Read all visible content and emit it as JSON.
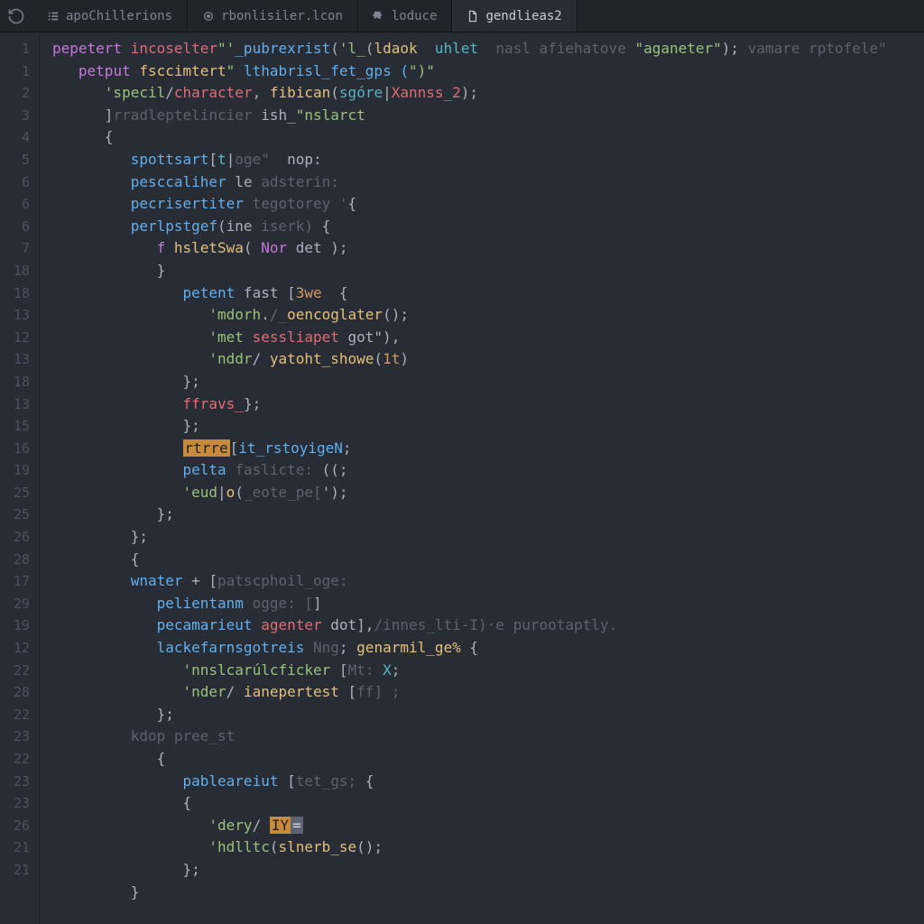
{
  "tabs": [
    {
      "label": "apoChillerions",
      "icon": "list-icon",
      "active": false
    },
    {
      "label": "rbonlisiler.lcon",
      "icon": "target-icon",
      "active": false
    },
    {
      "label": "loduce",
      "icon": "puzzle-icon",
      "active": false
    },
    {
      "label": "gendlieas2",
      "icon": "file-icon",
      "active": true
    }
  ],
  "gutter": [
    "1",
    "1",
    "2",
    "3",
    "4",
    "5",
    "6",
    "6",
    "6",
    "7",
    "18",
    "18",
    "13",
    "12",
    "13",
    "18",
    "13",
    "15",
    "16",
    "19",
    "25",
    "25",
    "26",
    "28",
    "17",
    "29",
    "19",
    "12",
    "22",
    "28",
    "22",
    "23",
    "22",
    "23",
    "23",
    "26",
    "21",
    "21"
  ],
  "code": {
    "lines": [
      {
        "indent": 0,
        "tokens": [
          [
            "kw",
            "pepetert"
          ],
          [
            "op",
            " "
          ],
          [
            "prop",
            "incoselter"
          ],
          [
            "str",
            "\"'"
          ],
          [
            "kw2",
            "_pubrexrist"
          ],
          [
            "op",
            "("
          ],
          [
            "str",
            "'l_"
          ],
          [
            "op",
            "("
          ],
          [
            "fn",
            "ldaok"
          ],
          [
            "op",
            "  "
          ],
          [
            "var",
            "uhlet"
          ],
          [
            "op",
            "  "
          ],
          [
            "com",
            "nasl afiehatove "
          ],
          [
            "str",
            "\"aganeter\""
          ],
          [
            "op",
            "); "
          ],
          [
            "com",
            "vamare rptofele\""
          ]
        ]
      },
      {
        "indent": 1,
        "tokens": [
          [
            "kw",
            "petput"
          ],
          [
            "op",
            " "
          ],
          [
            "fn",
            "fsccimtert"
          ],
          [
            "str",
            "\" "
          ],
          [
            "kw2",
            "lthabrisl_fet_gps ("
          ],
          [
            "str",
            "\")\""
          ]
        ]
      },
      {
        "indent": 2,
        "tokens": [
          [
            "str",
            "'specil"
          ],
          [
            "op",
            "/"
          ],
          [
            "prop",
            "character"
          ],
          [
            "op",
            ", "
          ],
          [
            "fn",
            "fibican"
          ],
          [
            "op",
            "("
          ],
          [
            "var",
            "sgóre"
          ],
          [
            "op",
            "|"
          ],
          [
            "prop",
            "Xannss_2"
          ],
          [
            "op",
            ");"
          ]
        ]
      },
      {
        "indent": 2,
        "tokens": [
          [
            "op",
            "]"
          ],
          [
            "com",
            "rradleptelincier"
          ],
          [
            "op",
            " ish_"
          ],
          [
            "str",
            "\"nslarct"
          ]
        ]
      },
      {
        "indent": 2,
        "tokens": [
          [
            "op",
            "{"
          ]
        ]
      },
      {
        "indent": 3,
        "tokens": [
          [
            "kw2",
            "spottsart"
          ],
          [
            "op",
            "["
          ],
          [
            "var",
            "t"
          ],
          [
            "op",
            "|"
          ],
          [
            "com",
            "oge\""
          ],
          [
            "op",
            "  nop:"
          ]
        ]
      },
      {
        "indent": 3,
        "tokens": [
          [
            "kw2",
            "pesccaliher"
          ],
          [
            "op",
            " le "
          ],
          [
            "com",
            "adsterin:"
          ]
        ]
      },
      {
        "indent": 3,
        "tokens": [
          [
            "kw2",
            "pecrisertiter"
          ],
          [
            "op",
            " "
          ],
          [
            "com",
            "tegotorey '"
          ],
          [
            "op",
            "{"
          ]
        ]
      },
      {
        "indent": 3,
        "tokens": [
          [
            "kw2",
            "perlpstgef"
          ],
          [
            "op",
            "(ine "
          ],
          [
            "com",
            "iserk) "
          ],
          [
            "op",
            "{"
          ]
        ]
      },
      {
        "indent": 4,
        "tokens": [
          [
            "kw",
            "f"
          ],
          [
            "op",
            " "
          ],
          [
            "fn",
            "hsletSwa"
          ],
          [
            "op",
            "( "
          ],
          [
            "kw",
            "Nor"
          ],
          [
            "op",
            " det );"
          ]
        ]
      },
      {
        "indent": 4,
        "tokens": [
          [
            "op",
            "}"
          ]
        ]
      },
      {
        "indent": 5,
        "tokens": [
          [
            "kw2",
            "petent"
          ],
          [
            "op",
            " fast "
          ],
          [
            "op",
            "["
          ],
          [
            "num",
            "3we"
          ],
          [
            "op",
            "  {"
          ]
        ]
      },
      {
        "indent": 6,
        "tokens": [
          [
            "str",
            "'mdorh"
          ],
          [
            "op",
            "."
          ],
          [
            "com",
            "/_"
          ],
          [
            "fn",
            "oencoglater"
          ],
          [
            "op",
            "();"
          ]
        ]
      },
      {
        "indent": 6,
        "tokens": [
          [
            "str",
            "'met"
          ],
          [
            "op",
            " "
          ],
          [
            "prop",
            "sessliapet"
          ],
          [
            "op",
            " got\"),"
          ]
        ]
      },
      {
        "indent": 6,
        "tokens": [
          [
            "str",
            "'nddr"
          ],
          [
            "op",
            "/ "
          ],
          [
            "fn",
            "yatoht_showe"
          ],
          [
            "op",
            "("
          ],
          [
            "num",
            "1t"
          ],
          [
            "op",
            ")"
          ]
        ]
      },
      {
        "indent": 5,
        "tokens": [
          [
            "op",
            "};"
          ]
        ]
      },
      {
        "indent": 5,
        "tokens": [
          [
            "prop",
            "ffravs_"
          ],
          [
            "op",
            "};"
          ]
        ]
      },
      {
        "indent": 5,
        "tokens": [
          [
            "op",
            "};"
          ]
        ]
      },
      {
        "indent": 5,
        "tokens": [
          [
            "hl",
            "rtrre"
          ],
          [
            "op",
            "["
          ],
          [
            "kw2",
            "it_rstoyigeN"
          ],
          [
            "op",
            ";"
          ]
        ]
      },
      {
        "indent": 5,
        "tokens": [
          [
            "kw2",
            "pelta"
          ],
          [
            "op",
            " "
          ],
          [
            "com",
            "faslicte: "
          ],
          [
            "op",
            "((;"
          ]
        ]
      },
      {
        "indent": 5,
        "tokens": [
          [
            "str",
            "'eud"
          ],
          [
            "op",
            "|"
          ],
          [
            "fn",
            "o"
          ],
          [
            "op",
            "("
          ],
          [
            "com",
            "_eote_pe["
          ],
          [
            "op",
            "');"
          ]
        ]
      },
      {
        "indent": 4,
        "tokens": [
          [
            "op",
            "};"
          ]
        ]
      },
      {
        "indent": 3,
        "tokens": [
          [
            "op",
            "};"
          ]
        ]
      },
      {
        "indent": 3,
        "tokens": [
          [
            "op",
            "{"
          ]
        ]
      },
      {
        "indent": 3,
        "tokens": [
          [
            "kw2",
            "wnater"
          ],
          [
            "op",
            " + ["
          ],
          [
            "com",
            "patscphoil_oge:"
          ]
        ]
      },
      {
        "indent": 4,
        "tokens": [
          [
            "kw2",
            "pelientanm"
          ],
          [
            "op",
            " "
          ],
          [
            "com",
            "ogge: ["
          ],
          [
            "op",
            "]"
          ]
        ]
      },
      {
        "indent": 4,
        "tokens": [
          [
            "kw2",
            "pecamarieut"
          ],
          [
            "op",
            " "
          ],
          [
            "prop",
            "agenter"
          ],
          [
            "op",
            " dot],"
          ],
          [
            "com",
            "/innes_lti-I)·e purootaptly."
          ]
        ]
      },
      {
        "indent": 4,
        "tokens": [
          [
            "kw2",
            "lackefarnsgotreis"
          ],
          [
            "op",
            " "
          ],
          [
            "com",
            "Nng"
          ],
          [
            "op",
            "; "
          ],
          [
            "fn",
            "genarmil_ge%"
          ],
          [
            "op",
            " {"
          ]
        ]
      },
      {
        "indent": 5,
        "tokens": [
          [
            "str",
            "'nnslcarúlcficker"
          ],
          [
            "op",
            " ["
          ],
          [
            "com",
            "Mt: "
          ],
          [
            "var",
            "X"
          ],
          [
            "op",
            ";"
          ]
        ]
      },
      {
        "indent": 5,
        "tokens": [
          [
            "str",
            "'nder"
          ],
          [
            "op",
            "/ "
          ],
          [
            "fn",
            "ianepertest"
          ],
          [
            "op",
            " ["
          ],
          [
            "com",
            "ff] ;"
          ]
        ]
      },
      {
        "indent": 4,
        "tokens": [
          [
            "op",
            "};"
          ]
        ]
      },
      {
        "indent": 3,
        "tokens": [
          [
            "com",
            "kdop pree_st"
          ]
        ]
      },
      {
        "indent": 4,
        "tokens": [
          [
            "op",
            "{"
          ]
        ]
      },
      {
        "indent": 5,
        "tokens": [
          [
            "kw2",
            "pableareiut"
          ],
          [
            "op",
            " ["
          ],
          [
            "com",
            "tet_gs; "
          ],
          [
            "op",
            "{"
          ]
        ]
      },
      {
        "indent": 5,
        "tokens": [
          [
            "op",
            "{"
          ]
        ]
      },
      {
        "indent": 6,
        "tokens": [
          [
            "str",
            "'dery"
          ],
          [
            "op",
            "/ "
          ],
          [
            "hl",
            "IY"
          ],
          [
            "hl2",
            "="
          ]
        ]
      },
      {
        "indent": 6,
        "tokens": [
          [
            "str",
            "'hdlltc"
          ],
          [
            "op",
            "("
          ],
          [
            "fn",
            "slnerb_se"
          ],
          [
            "op",
            "();"
          ]
        ]
      },
      {
        "indent": 5,
        "tokens": [
          [
            "op",
            "};"
          ]
        ]
      },
      {
        "indent": 3,
        "tokens": [
          [
            "op",
            "}"
          ]
        ]
      }
    ]
  },
  "fold_rows": [
    21,
    31
  ]
}
